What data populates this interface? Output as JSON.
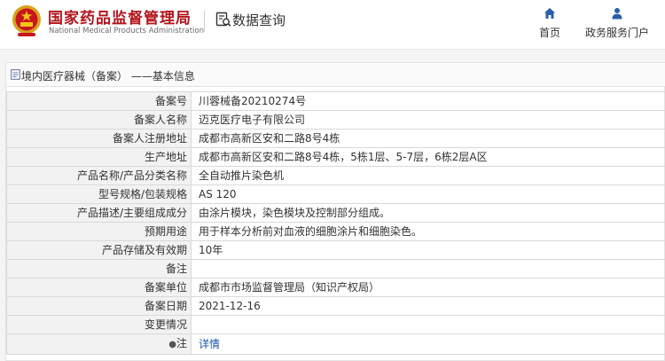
{
  "header": {
    "logo_cn": "国家药品监督管理局",
    "logo_en": "National Medical Products Administration",
    "query_title": "数据查询",
    "nav": {
      "home": "首页",
      "portal": "政务服务门户"
    }
  },
  "breadcrumb": {
    "text": "境内医疗器械（备案） ——基本信息"
  },
  "rows": [
    {
      "label": "备案号",
      "value": "川蓉械备20210274号"
    },
    {
      "label": "备案人名称",
      "value": "迈克医疗电子有限公司"
    },
    {
      "label": "备案人注册地址",
      "value": "成都市高新区安和二路8号4栋"
    },
    {
      "label": "生产地址",
      "value": "成都市高新区安和二路8号4栋，5栋1层、5-7层，6栋2层A区"
    },
    {
      "label": "产品名称/产品分类名称",
      "value": "全自动推片染色机"
    },
    {
      "label": "型号规格/包装规格",
      "value": "AS 120"
    },
    {
      "label": "产品描述/主要组成成分",
      "value": "由涂片模块，染色模块及控制部分组成。"
    },
    {
      "label": "预期用途",
      "value": "用于样本分析前对血液的细胞涂片和细胞染色。"
    },
    {
      "label": "产品存储及有效期",
      "value": "10年"
    },
    {
      "label": "备注",
      "value": ""
    },
    {
      "label": "备案单位",
      "value": "成都市市场监督管理局（知识产权局）"
    },
    {
      "label": "备案日期",
      "value": "2021-12-16"
    },
    {
      "label": "变更情况",
      "value": ""
    }
  ],
  "note_row": {
    "label": "注",
    "link": "详情"
  },
  "colors": {
    "brand_red": "#b3141c",
    "nav_blue": "#2a5ea8",
    "link_blue": "#1a56a8"
  }
}
